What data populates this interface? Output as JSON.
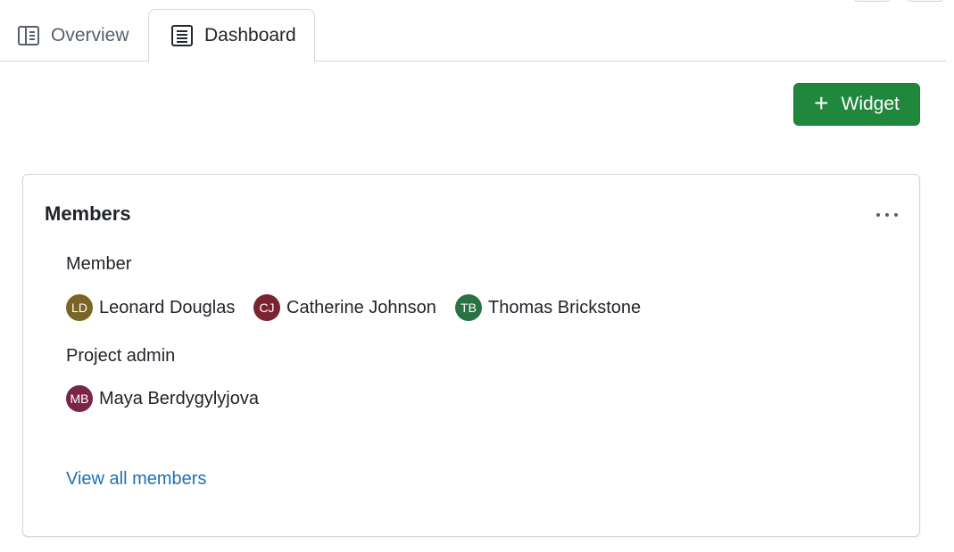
{
  "tabs": [
    {
      "label": "Overview",
      "icon": "book-icon",
      "active": false
    },
    {
      "label": "Dashboard",
      "icon": "list-icon",
      "active": true
    }
  ],
  "toolbar": {
    "widget_label": "Widget",
    "widget_icon": "plus-icon",
    "accent_color": "#1f883d"
  },
  "members_card": {
    "title": "Members",
    "groups": [
      {
        "role": "Member",
        "people": [
          {
            "initials": "LD",
            "name": "Leonard Douglas",
            "color": "#7b6526"
          },
          {
            "initials": "CJ",
            "name": "Catherine Johnson",
            "color": "#7a2431"
          },
          {
            "initials": "TB",
            "name": "Thomas Brickstone",
            "color": "#2b7243"
          }
        ]
      },
      {
        "role": "Project admin",
        "people": [
          {
            "initials": "MB",
            "name": "Maya Berdygylyjova",
            "color": "#7a2446"
          }
        ]
      }
    ],
    "view_all_label": "View all members"
  }
}
